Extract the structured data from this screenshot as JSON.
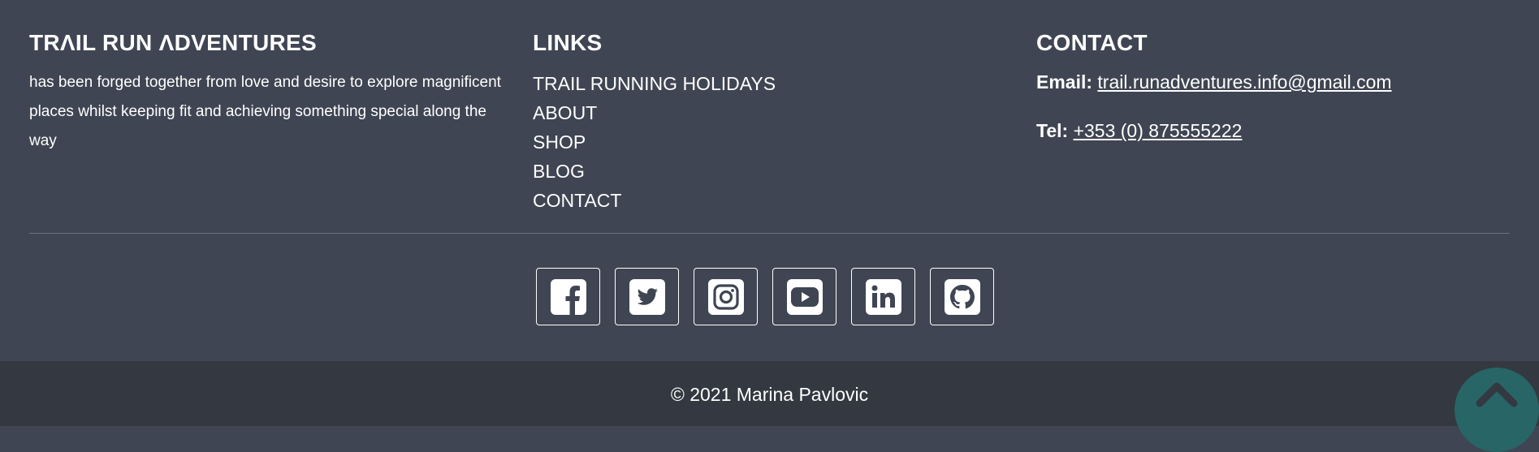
{
  "about": {
    "title": "TRΛIL RUN ΛDVENTURES",
    "text": "has been forged together from love and desire to explore magnificent places whilst keeping fit and achieving something special along the way"
  },
  "links": {
    "title": "LINKS",
    "items": [
      {
        "label": "TRAIL RUNNING HOLIDAYS"
      },
      {
        "label": "ABOUT"
      },
      {
        "label": "SHOP"
      },
      {
        "label": "BLOG"
      },
      {
        "label": "CONTACT"
      }
    ]
  },
  "contact": {
    "title": "CONTACT",
    "email_label": "Email:",
    "email": "trail.runadventures.info@gmail.com",
    "tel_label": "Tel:",
    "tel": "+353 (0) 875555222"
  },
  "social": {
    "icons": [
      "facebook-icon",
      "twitter-icon",
      "instagram-icon",
      "youtube-icon",
      "linkedin-icon",
      "github-icon"
    ]
  },
  "footer": {
    "copyright": "© 2021 Marina Pavlovic"
  },
  "colors": {
    "footer_bg": "#3f4552",
    "bottom_bar_bg": "#343840",
    "scroll_top_bg": "#276566"
  }
}
